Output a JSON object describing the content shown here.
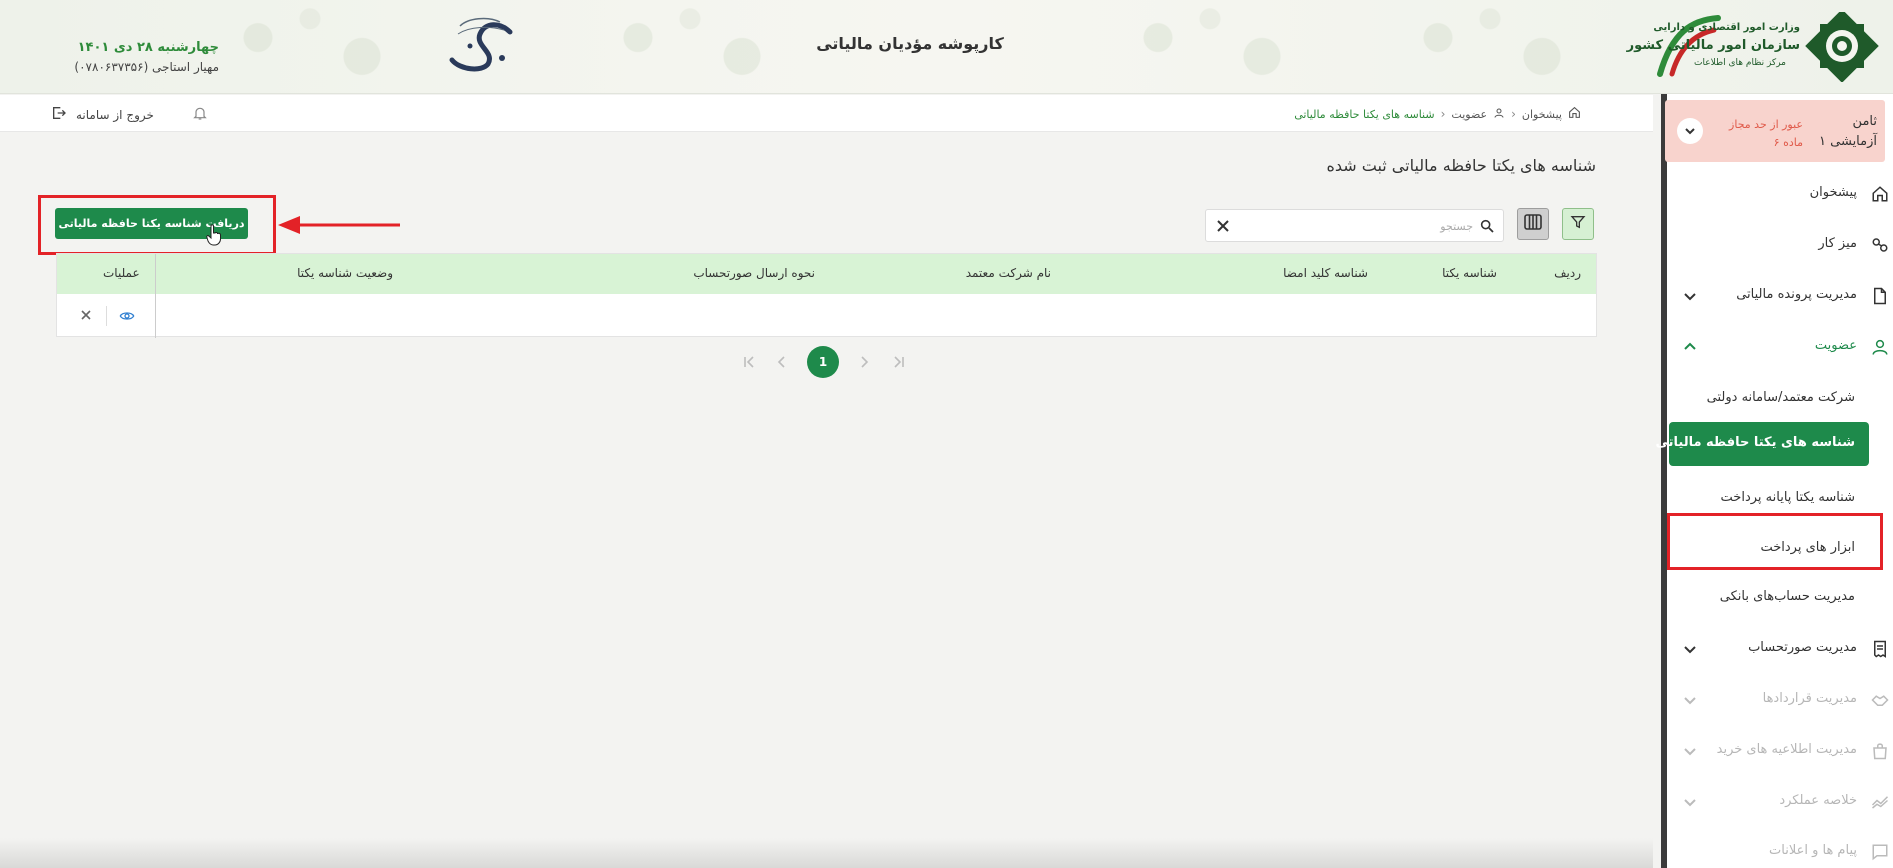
{
  "header": {
    "title": "کارپوشه مؤدیان مالیاتی",
    "date": "چهارشنبه ۲۸ دی ۱۴۰۱",
    "user": "مهیار استاجی (۰۷۸۰۶۳۷۳۵۶)",
    "org_line1": "وزارت امور اقتصادی و دارایی",
    "org_line2": "سازمان امور مالیاتی کشور",
    "org_line3": "مرکز نظام های اطلاعات",
    "tolid_logo": "تولید"
  },
  "topbar": {
    "breadcrumb": [
      "پیشخوان",
      "عضویت",
      "شناسه های یکتا حافظه مالیاتی"
    ],
    "logout_label": "خروج از سامانه"
  },
  "sidebar": {
    "tenant_name1": "ثامن",
    "tenant_name2": "آزمایشی ۱",
    "tenant_warning1": "عبور از حد مجاز",
    "tenant_warning2": "ماده ۶",
    "items": [
      {
        "label": "پیشخوان",
        "icon": "home-icon"
      },
      {
        "label": "میز کار",
        "icon": "workdesk-icon"
      },
      {
        "label": "مدیریت پرونده مالیاتی",
        "icon": "file-icon"
      },
      {
        "label": "عضویت",
        "icon": "user-icon"
      },
      {
        "label": "مدیریت صورتحساب",
        "icon": "invoice-icon"
      },
      {
        "label": "مدیریت قراردادها",
        "icon": "handshake-icon"
      },
      {
        "label": "مدیریت اطلاعیه های خرید",
        "icon": "shopping-bag-icon"
      },
      {
        "label": "خلاصه عملکرد",
        "icon": "chart-line-icon"
      },
      {
        "label": "پیام ها و اعلانات",
        "icon": "message-icon"
      }
    ],
    "sub_items": [
      {
        "label": "شرکت معتمد/سامانه دولتی"
      },
      {
        "label": "شناسه های یکتا حافظه مالیاتی"
      },
      {
        "label": "شناسه یکتا پایانه پرداخت"
      },
      {
        "label": "ابزار های پرداخت"
      },
      {
        "label": "مدیریت حساب‌های بانکی"
      }
    ]
  },
  "main": {
    "page_title": "شناسه های یکتا حافظه مالیاتی ثبت شده",
    "primary_button": "دریافت شناسه یکتا حافظه مالیاتی",
    "search_placeholder": "جستجو",
    "columns": [
      "ردیف",
      "شناسه یکتا",
      "شناسه کلید امضا",
      "نام شرکت معتمد",
      "نحوه ارسال صورتحساب",
      "وضعیت شناسه یکتا",
      "عملیات"
    ],
    "current_page": "1"
  },
  "colors": {
    "primary": "#1e8a4b",
    "header_green": "#2e8b3a",
    "table_header": "#d8f3d5",
    "warning_bg": "#f8d3cd",
    "annotation_red": "#e32227"
  }
}
